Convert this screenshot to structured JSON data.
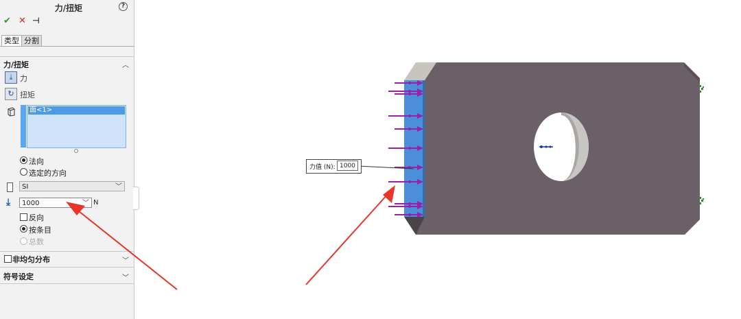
{
  "panel": {
    "title": "力/扭矩",
    "help_icon": "?",
    "actions": {
      "ok": "✔",
      "cancel": "✕",
      "pin": "⊣"
    },
    "tabs": [
      {
        "label": "类型"
      },
      {
        "label": "分割"
      }
    ],
    "force_torque": {
      "heading": "力/扭矩",
      "force_label": "力",
      "torque_label": "扭矩",
      "face_item": "面<1>",
      "direction_normal": "法向",
      "direction_selected": "选定的方向",
      "units": "SI",
      "force_value": "1000",
      "force_unit": "N",
      "reverse": "反向",
      "per_item": "按条目",
      "total": "总数"
    },
    "nonuniform": {
      "label": "非均匀分布"
    },
    "symbol": {
      "label": "符号设定"
    }
  },
  "viewport": {
    "callout_label": "力值 (N):",
    "callout_value": "1000",
    "colors": {
      "part_face": "#6b6067",
      "selected_face": "#4a8fd8",
      "arrow": "#9b1fae",
      "annotation": "#e8352a"
    }
  }
}
